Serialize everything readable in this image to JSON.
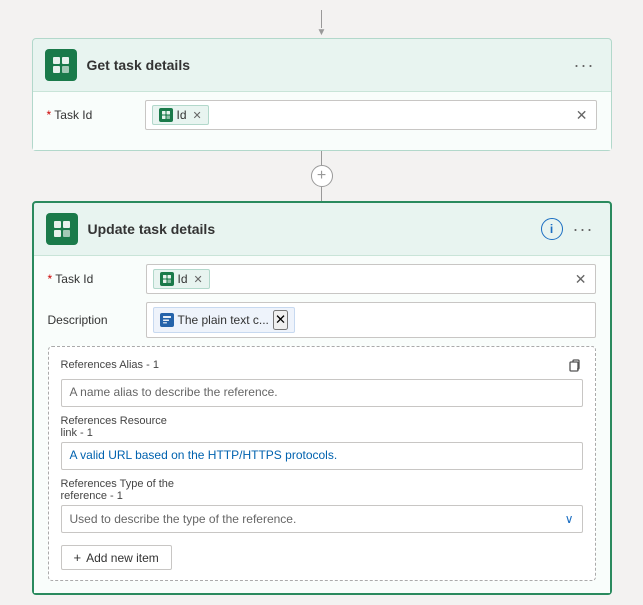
{
  "top_arrow": "↓",
  "get_task": {
    "title": "Get task details",
    "task_id_label": "Task Id",
    "task_id_chip_label": "Id",
    "icon_alt": "planner-icon"
  },
  "connector": {
    "plus_symbol": "+"
  },
  "update_task": {
    "title": "Update task details",
    "task_id_label": "Task Id",
    "task_id_chip_label": "Id",
    "description_label": "Description",
    "description_chip_label": "The plain text c...",
    "references_alias_section": "References Alias - 1",
    "references_alias_placeholder": "A name alias to describe the reference.",
    "references_resource_section": "References Resource\nlink - 1",
    "references_resource_placeholder": "A valid URL based on the HTTP/HTTPS protocols.",
    "references_type_section": "References Type of the\nreference - 1",
    "references_type_placeholder": "Used to describe the type of the reference.",
    "add_item_label": "Add new item",
    "info_label": "i"
  }
}
